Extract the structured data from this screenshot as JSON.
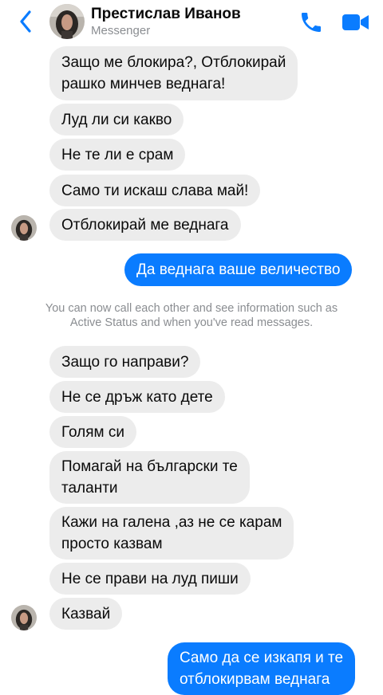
{
  "header": {
    "contact_name": "Престислав Иванов",
    "subtitle": "Messenger",
    "back_icon": "chevron-left-icon",
    "call_icon": "phone-icon",
    "video_icon": "video-camera-icon",
    "accent_color": "#0a7cff"
  },
  "messages": {
    "m1": "Защо ме блокира?, Отблокирай",
    "m1b": "рашко минчев веднага!",
    "m2": "Луд ли си какво",
    "m3": "Не те ли е срам",
    "m4": "Само ти искаш слава май!",
    "m5": "Отблокирай ме веднага",
    "m6": "Да веднага ваше величество",
    "m7": "Защо го направи?",
    "m8": "Не се дръж като дете",
    "m9": "Голям си",
    "m10": "Помагай на български те",
    "m10b": "таланти",
    "m11": "Кажи на галена ,аз не се карам",
    "m11b": "просто казвам",
    "m12": "Не се прави на луд пиши",
    "m13": "Казвай",
    "m14": "Само да се изкапя и те",
    "m14b": "отблокирвам веднага"
  },
  "system_note": "You can now call each other and see information such as\nActive Status and when you've read messages.",
  "colors": {
    "incoming_bubble": "#ececec",
    "outgoing_bubble": "#0a7cff",
    "muted_text": "#8a8d91"
  }
}
